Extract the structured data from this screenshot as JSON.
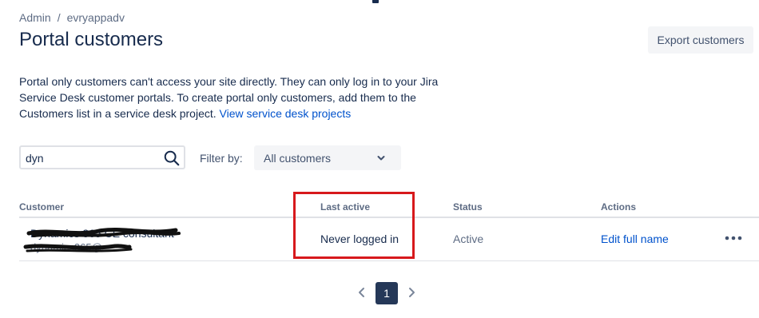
{
  "breadcrumb": {
    "items": [
      "Admin",
      "evryappadv"
    ],
    "separator": "/"
  },
  "page": {
    "title": "Portal customers"
  },
  "toolbar": {
    "export_label": "Export customers"
  },
  "description": {
    "text": "Portal only customers can't access your site directly. They can only log in to your Jira Service Desk customer portals. To create portal only customers, add them to the Customers list in a service desk project.",
    "link": "View service desk projects"
  },
  "search": {
    "value": "dyn",
    "icon": "search-icon"
  },
  "filter": {
    "label": "Filter by:",
    "selected": "All customers"
  },
  "table": {
    "headers": {
      "customer": "Customer",
      "last_active": "Last active",
      "status": "Status",
      "actions": "Actions"
    },
    "rows": [
      {
        "name": "Dynamics 365 CE consultant",
        "email": "dynamics365@",
        "last_active": "Never logged in",
        "status": "Active",
        "action": "Edit full name"
      }
    ]
  },
  "pagination": {
    "current": "1"
  },
  "colors": {
    "link": "#0052cc",
    "highlight": "#d7191c",
    "page_active": "#253858"
  }
}
